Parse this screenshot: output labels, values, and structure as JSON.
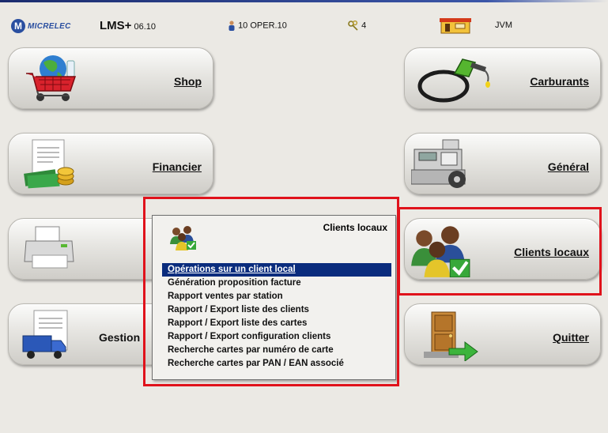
{
  "header": {
    "brand": "MICRELEC",
    "app_name": "LMS+",
    "version": "06.10",
    "operator_count": "10",
    "operator": "OPER.10",
    "keys_count": "4",
    "station": "JVM"
  },
  "tiles": {
    "shop": {
      "label": "Shop",
      "icon": "shopping-cart-globe-icon"
    },
    "carburants": {
      "label": "Carburants",
      "icon": "fuel-nozzle-icon"
    },
    "financier": {
      "label": "Financier",
      "icon": "money-documents-icon"
    },
    "general": {
      "label": "Général",
      "icon": "cash-register-icon"
    },
    "printer": {
      "label": "",
      "icon": "printer-icon"
    },
    "clients_locaux": {
      "label": "Clients locaux",
      "icon": "clients-group-check-icon"
    },
    "gestion": {
      "label": "Gestion",
      "icon": "truck-document-icon"
    },
    "quitter": {
      "label": "Quitter",
      "icon": "exit-door-icon"
    }
  },
  "popup": {
    "title": "Clients locaux",
    "items": [
      "Opérations sur un client local",
      "Génération proposition facture",
      "Rapport ventes par station",
      "Rapport / Export liste des clients",
      "Rapport / Export liste des cartes",
      "Rapport / Export configuration clients",
      "Recherche cartes par numéro de carte",
      "Recherche cartes par PAN / EAN associé"
    ],
    "selected_index": 0
  },
  "colors": {
    "highlight": "#e0121b",
    "selection": "#0a2c7d",
    "background": "#ebe9e4"
  }
}
